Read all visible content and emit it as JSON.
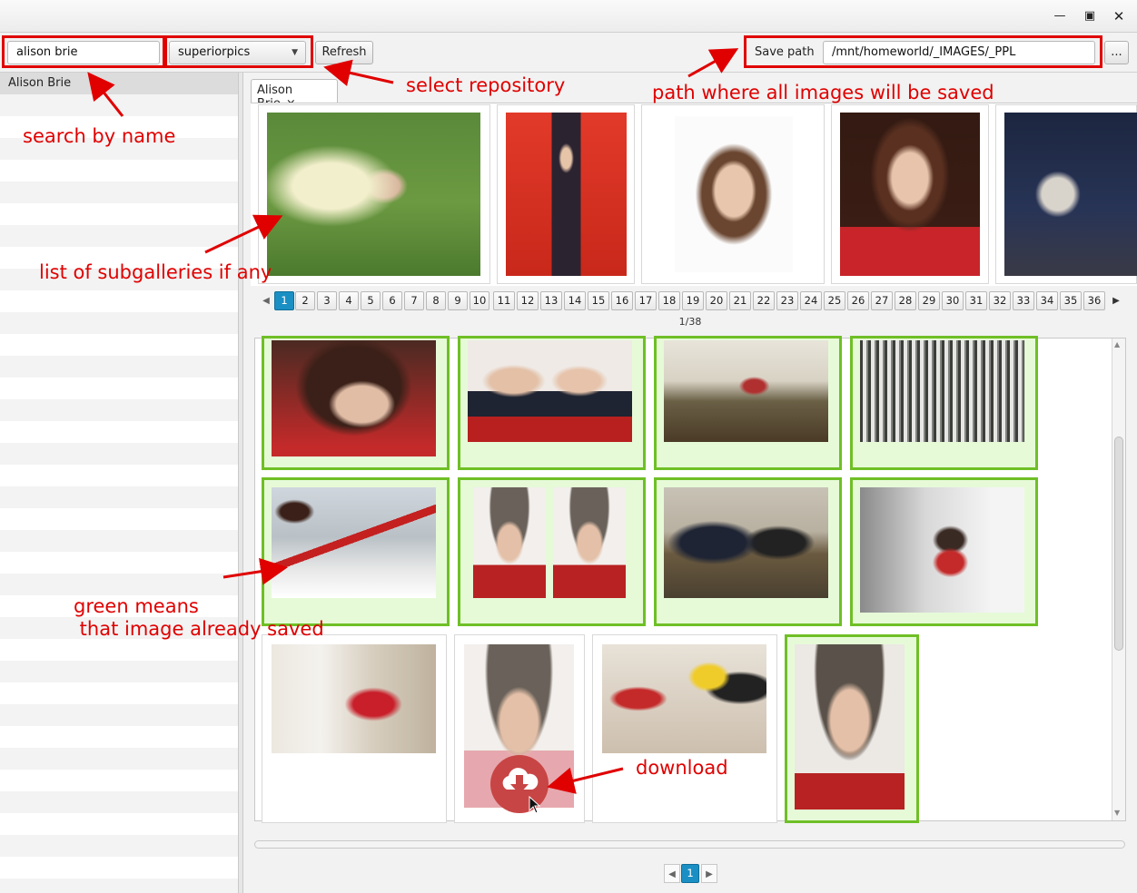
{
  "window": {
    "minimize_icon": "minimize-icon",
    "maximize_icon": "maximize-icon",
    "close_icon": "close-icon"
  },
  "toolbar": {
    "search_value": "alison brie",
    "repository_value": "superiorpics",
    "refresh_label": "Refresh",
    "save_path_label": "Save path",
    "save_path_value": "/mnt/homeworld/_IMAGES/_PPL",
    "browse_label": "..."
  },
  "sidebar": {
    "items": [
      {
        "label": "Alison Brie"
      }
    ]
  },
  "tabs": [
    {
      "label": "Alison Brie",
      "close": "×"
    }
  ],
  "pagination": {
    "prev": "◀",
    "next": "▶",
    "pages": [
      "1",
      "2",
      "3",
      "4",
      "5",
      "6",
      "7",
      "8",
      "9",
      "10",
      "11",
      "12",
      "13",
      "14",
      "15",
      "16",
      "17",
      "18",
      "19",
      "20",
      "21",
      "22",
      "23",
      "24",
      "25",
      "26",
      "27",
      "28",
      "29",
      "30",
      "31",
      "32",
      "33",
      "34",
      "35",
      "36"
    ],
    "current": "1",
    "status": "1/38"
  },
  "bottom_pagination": {
    "prev": "◀",
    "next": "▶",
    "current": "1"
  },
  "annotations": {
    "search": "search by name",
    "repository": "select repository",
    "save_path": "path where all images will be saved",
    "subgalleries": "list of subgalleries if any",
    "green_line1": "green means",
    "green_line2": " that image already saved",
    "download": "download"
  },
  "colors": {
    "annotation_red": "#e00000",
    "saved_green": "#6fbf26",
    "saved_bg": "#e6fad8",
    "active_page": "#1a8fc4",
    "download_button": "#c84545"
  },
  "icons": {
    "download": "cloud-download-icon",
    "dropdown": "chevron-down-icon",
    "cursor": "mouse-cursor-icon"
  }
}
